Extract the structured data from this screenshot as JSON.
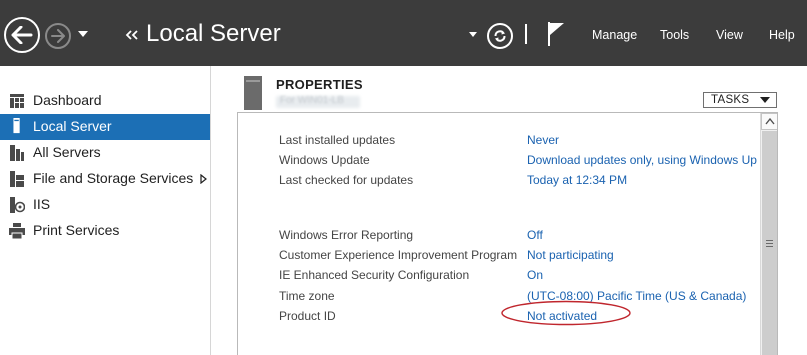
{
  "window": {
    "title": "Local Server"
  },
  "menu": {
    "items": [
      "Manage",
      "Tools",
      "View",
      "Help"
    ]
  },
  "icons": {
    "back": "back-arrow-icon",
    "forward": "forward-arrow-icon",
    "refresh": "refresh-icon",
    "notifications": "flag-icon"
  },
  "colors": {
    "titlebar_bg": "#3c3c3c",
    "selected_bg": "#1c6fb5",
    "link": "#1a62b0",
    "annotation": "#c0262d"
  },
  "sidebar": {
    "items": [
      {
        "label": "Dashboard",
        "icon": "dashboard-icon",
        "selected": false
      },
      {
        "label": "Local Server",
        "icon": "local-server-icon",
        "selected": true
      },
      {
        "label": "All Servers",
        "icon": "all-servers-icon",
        "selected": false
      },
      {
        "label": "File and Storage Services",
        "icon": "file-storage-icon",
        "selected": false,
        "has_children": true
      },
      {
        "label": "IIS",
        "icon": "iis-icon",
        "selected": false
      },
      {
        "label": "Print Services",
        "icon": "printer-icon",
        "selected": false
      }
    ]
  },
  "properties": {
    "heading": "PROPERTIES",
    "server_name": "For WIN01-LB",
    "tasks_label": "TASKS",
    "groups": [
      [
        {
          "label": "Last installed updates",
          "value": "Never"
        },
        {
          "label": "Windows Update",
          "value": "Download updates only, using Windows Up"
        },
        {
          "label": "Last checked for updates",
          "value": "Today at 12:34 PM"
        }
      ],
      [
        {
          "label": "Windows Error Reporting",
          "value": "Off"
        },
        {
          "label": "Customer Experience Improvement Program",
          "value": "Not participating"
        },
        {
          "label": "IE Enhanced Security Configuration",
          "value": "On"
        },
        {
          "label": "Time zone",
          "value": "(UTC-08:00) Pacific Time (US & Canada)"
        },
        {
          "label": "Product ID",
          "value": "Not activated",
          "highlighted": true
        }
      ]
    ]
  }
}
